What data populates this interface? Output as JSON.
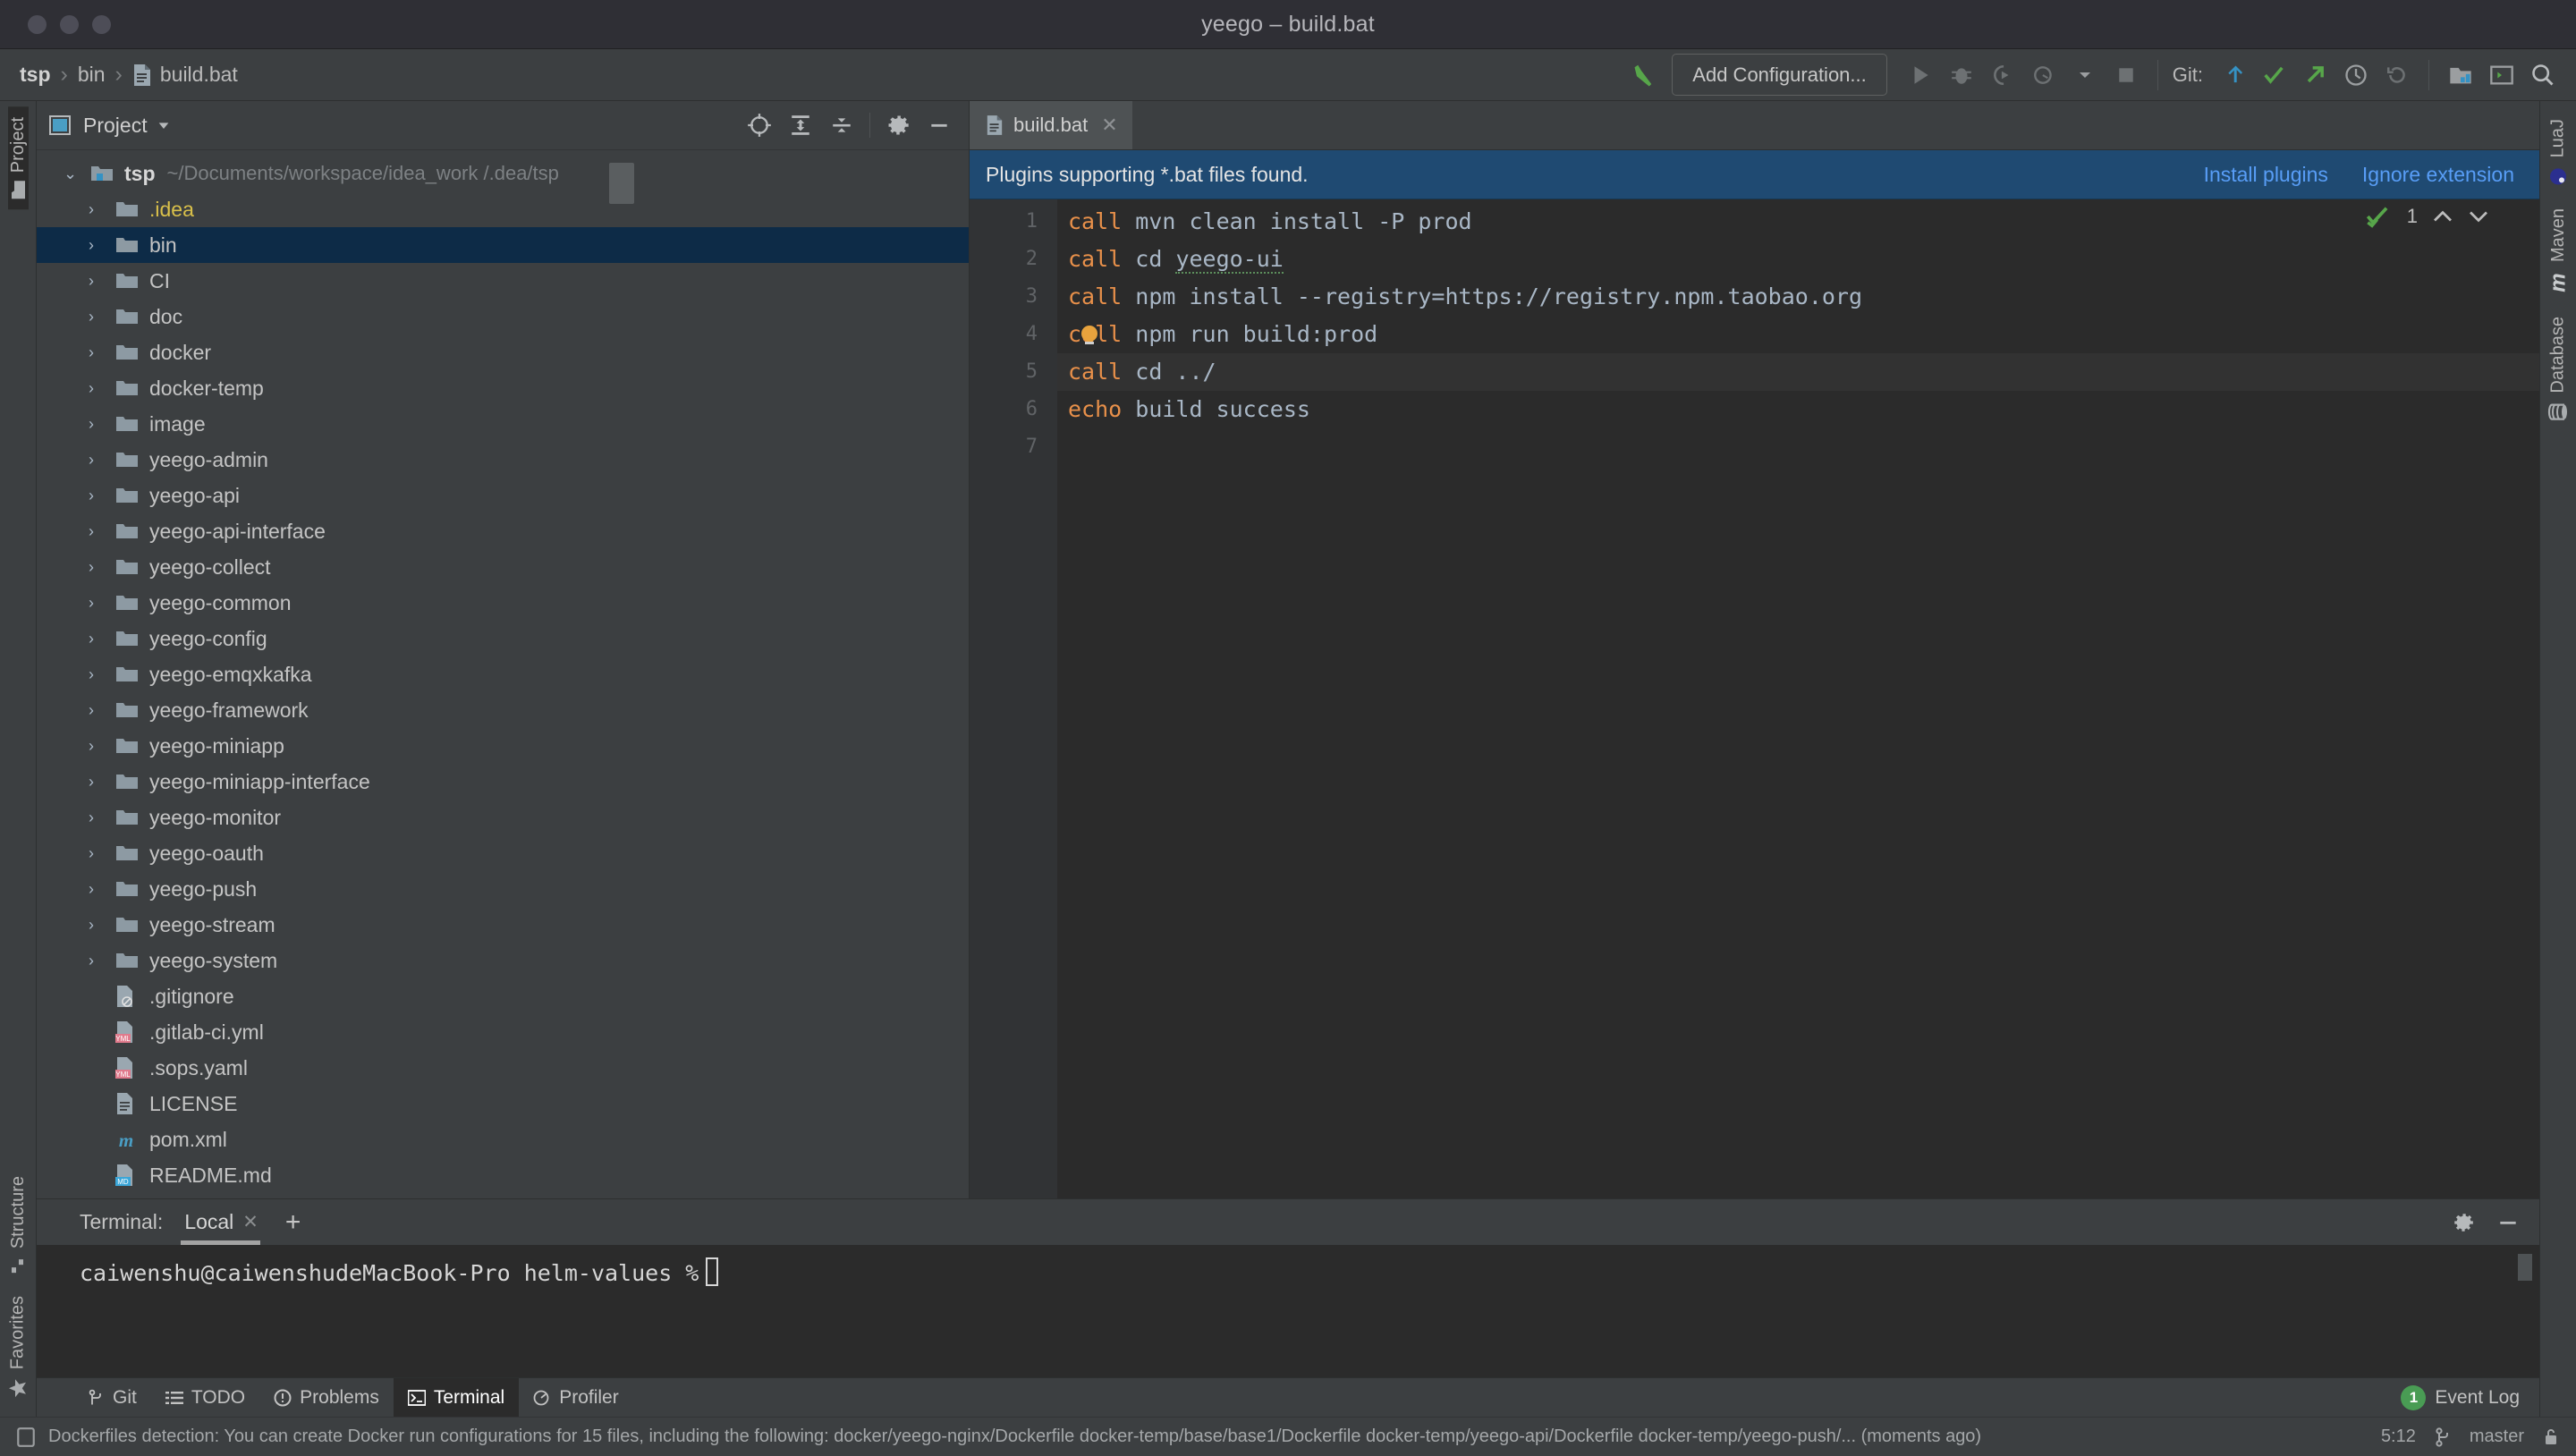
{
  "window": {
    "title": "yeego – build.bat"
  },
  "breadcrumb": {
    "root": "tsp",
    "folder": "bin",
    "file": "build.bat"
  },
  "toolbar": {
    "add_configuration": "Add Configuration...",
    "git_label": "Git:",
    "icons": {
      "hammer": "build-hammer-icon",
      "run": "run-icon",
      "debug": "debug-icon",
      "run_coverage": "run-with-coverage-icon",
      "profile": "profile-icon",
      "dropdown": "chevron-down-icon",
      "stop": "stop-icon",
      "update": "git-update-icon",
      "commit": "git-commit-icon",
      "push": "git-push-icon",
      "history": "git-history-icon",
      "rollback": "git-rollback-icon",
      "search_everywhere": "search-icon",
      "layout": "layout-icon",
      "terminal_toggle": "terminal-icon"
    }
  },
  "rail_left": {
    "project": "Project",
    "structure": "Structure",
    "favorites": "Favorites"
  },
  "rail_right": {
    "luaj": "LuaJ",
    "maven": "Maven",
    "database": "Database"
  },
  "project_panel": {
    "title": "Project",
    "dropdown": "chevron-down-icon",
    "actions": {
      "locate": "select-opened-file-icon",
      "expand": "expand-all-icon",
      "collapse": "collapse-all-icon",
      "settings": "gear-icon",
      "hide": "minimize-icon"
    },
    "root": {
      "name": "tsp",
      "path": "~/Documents/workspace/idea_work               /.dea/tsp"
    },
    "tree": [
      {
        "label": ".idea",
        "type": "folder",
        "color": "yellow",
        "selected": false
      },
      {
        "label": "bin",
        "type": "folder",
        "color": "default",
        "selected": true
      },
      {
        "label": "CI",
        "type": "folder",
        "color": "default",
        "selected": false
      },
      {
        "label": "doc",
        "type": "folder",
        "color": "default",
        "selected": false
      },
      {
        "label": "docker",
        "type": "folder",
        "color": "default",
        "selected": false
      },
      {
        "label": "docker-temp",
        "type": "folder",
        "color": "default",
        "selected": false
      },
      {
        "label": "image",
        "type": "folder",
        "color": "default",
        "selected": false
      },
      {
        "label": "yeego-admin",
        "type": "folder",
        "color": "default",
        "selected": false
      },
      {
        "label": "yeego-api",
        "type": "folder",
        "color": "default",
        "selected": false
      },
      {
        "label": "yeego-api-interface",
        "type": "folder",
        "color": "default",
        "selected": false
      },
      {
        "label": "yeego-collect",
        "type": "folder",
        "color": "default",
        "selected": false
      },
      {
        "label": "yeego-common",
        "type": "folder",
        "color": "default",
        "selected": false
      },
      {
        "label": "yeego-config",
        "type": "folder",
        "color": "default",
        "selected": false
      },
      {
        "label": "yeego-emqxkafka",
        "type": "folder",
        "color": "default",
        "selected": false
      },
      {
        "label": "yeego-framework",
        "type": "folder",
        "color": "default",
        "selected": false
      },
      {
        "label": "yeego-miniapp",
        "type": "folder",
        "color": "default",
        "selected": false
      },
      {
        "label": "yeego-miniapp-interface",
        "type": "folder",
        "color": "default",
        "selected": false
      },
      {
        "label": "yeego-monitor",
        "type": "folder",
        "color": "default",
        "selected": false
      },
      {
        "label": "yeego-oauth",
        "type": "folder",
        "color": "default",
        "selected": false
      },
      {
        "label": "yeego-push",
        "type": "folder",
        "color": "default",
        "selected": false
      },
      {
        "label": "yeego-stream",
        "type": "folder",
        "color": "default",
        "selected": false
      },
      {
        "label": "yeego-system",
        "type": "folder",
        "color": "default",
        "selected": false
      },
      {
        "label": ".gitignore",
        "type": "file",
        "icon": "gitignore-file-icon",
        "selected": false
      },
      {
        "label": ".gitlab-ci.yml",
        "type": "file",
        "icon": "yml-file-icon",
        "selected": false
      },
      {
        "label": ".sops.yaml",
        "type": "file",
        "icon": "yml-file-icon",
        "selected": false
      },
      {
        "label": "LICENSE",
        "type": "file",
        "icon": "text-file-icon",
        "selected": false
      },
      {
        "label": "pom.xml",
        "type": "file",
        "icon": "maven-file-icon",
        "selected": false
      },
      {
        "label": "README.md",
        "type": "file",
        "icon": "md-file-icon",
        "selected": false
      }
    ]
  },
  "editor": {
    "tab": {
      "label": "build.bat",
      "icon": "bat-file-icon",
      "close": "close-icon"
    },
    "notification": {
      "text": "Plugins supporting *.bat files found.",
      "install": "Install plugins",
      "ignore": "Ignore extension"
    },
    "inspection": {
      "count": "1",
      "up": "chevron-up-icon",
      "down": "chevron-down-icon"
    },
    "line_numbers": [
      "1",
      "2",
      "3",
      "4",
      "5",
      "6",
      "7"
    ],
    "lines": [
      {
        "kw": "call",
        "rest": " mvn clean install -P prod",
        "highlight": false,
        "squiggle": ""
      },
      {
        "kw": "call",
        "rest": " cd ",
        "highlight": false,
        "squiggle": "yeego-ui"
      },
      {
        "kw": "call",
        "rest": " npm install --registry=https://registry.npm.taobao.org",
        "highlight": false,
        "squiggle": ""
      },
      {
        "kw": "call",
        "rest": " npm run build:prod",
        "highlight": false,
        "squiggle": "",
        "bulb": true
      },
      {
        "kw": "call",
        "rest": " cd ../",
        "highlight": true,
        "squiggle": ""
      },
      {
        "kw": "echo",
        "rest": " build success",
        "highlight": false,
        "squiggle": ""
      },
      {
        "kw": "",
        "rest": "",
        "highlight": false,
        "squiggle": ""
      }
    ]
  },
  "terminal": {
    "label": "Terminal:",
    "tab": "Local",
    "close": "close-icon",
    "add": "+",
    "settings": "gear-icon",
    "hide": "minimize-icon",
    "prompt": "caiwenshu@caiwenshudeMacBook-Pro helm-values %"
  },
  "bottom_tabs": [
    {
      "label": "Git",
      "icon": "git-branch-icon",
      "active": false
    },
    {
      "label": "TODO",
      "icon": "list-icon",
      "active": false
    },
    {
      "label": "Problems",
      "icon": "warning-icon",
      "active": false
    },
    {
      "label": "Terminal",
      "icon": "terminal-icon",
      "active": true
    },
    {
      "label": "Profiler",
      "icon": "profiler-icon",
      "active": false
    }
  ],
  "event_log": {
    "count": "1",
    "label": "Event Log"
  },
  "statusbar": {
    "icon": "notification-icon",
    "message": "Dockerfiles detection: You can create Docker run configurations for 15 files, including the following: docker/yeego-nginx/Dockerfile docker-temp/base/base1/Dockerfile docker-temp/yeego-api/Dockerfile docker-temp/yeego-push/... (moments ago)",
    "position": "5:12",
    "branch": "master",
    "branch_icon": "git-branch-icon",
    "lock_icon": "lock-icon"
  },
  "colors": {
    "accent_blue": "#589df6",
    "selection": "#0d2b47",
    "keyword": "#e8904a",
    "green": "#499c54",
    "notification_bg": "#1f4a72"
  }
}
